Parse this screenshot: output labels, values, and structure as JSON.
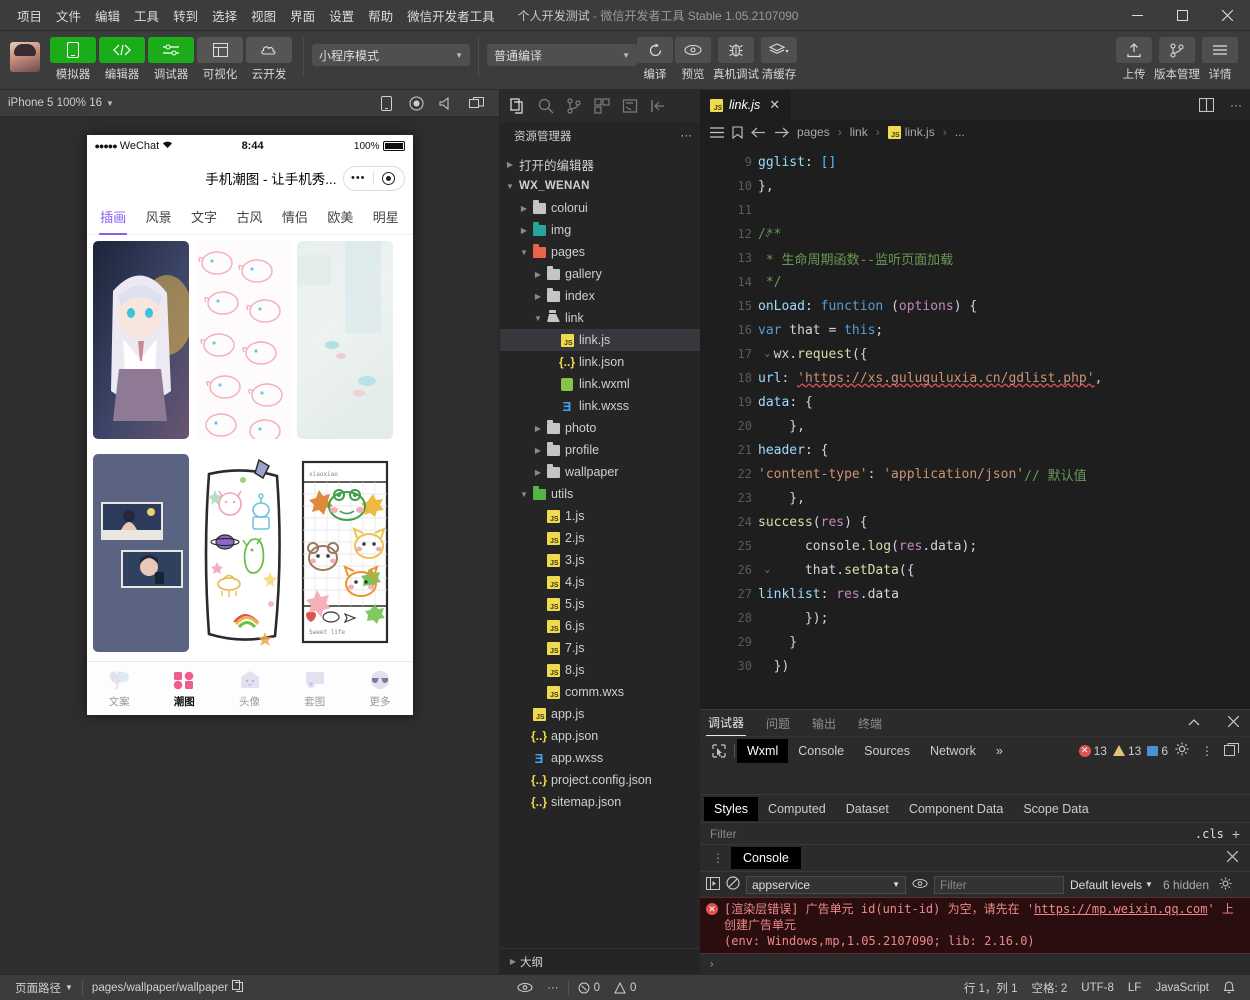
{
  "titlebar": {
    "menu": [
      "项目",
      "文件",
      "编辑",
      "工具",
      "转到",
      "选择",
      "视图",
      "界面",
      "设置",
      "帮助",
      "微信开发者工具"
    ],
    "project": "个人开发测试",
    "app": "- 微信开发者工具 Stable 1.05.2107090",
    "minimize": "—",
    "maximize": "▢",
    "close": "✕"
  },
  "toolbar": {
    "buttons": [
      {
        "label": "模拟器",
        "icon": "phone-icon",
        "style": "green"
      },
      {
        "label": "编辑器",
        "icon": "code-icon",
        "style": "green"
      },
      {
        "label": "调试器",
        "icon": "sliders-icon",
        "style": "green"
      },
      {
        "label": "可视化",
        "icon": "layout-icon",
        "style": "grey"
      },
      {
        "label": "云开发",
        "icon": "cloud-icon",
        "style": "grey"
      }
    ],
    "mode_select": "小程序模式",
    "compile_select": "普通编译",
    "actions": [
      {
        "label": "编译",
        "icon": "refresh-icon"
      },
      {
        "label": "预览",
        "icon": "eye-icon"
      },
      {
        "label": "真机调试",
        "icon": "bug-icon"
      },
      {
        "label": "清缓存",
        "icon": "layers-icon"
      }
    ],
    "right_actions": [
      {
        "label": "上传",
        "icon": "upload-icon"
      },
      {
        "label": "版本管理",
        "icon": "branch-icon"
      },
      {
        "label": "详情",
        "icon": "menu-icon"
      }
    ]
  },
  "simulator": {
    "device": "iPhone 5 100% 16",
    "icons": [
      "phone-rotate-icon",
      "record-icon",
      "volume-icon",
      "screenshot-icon"
    ],
    "phone": {
      "carrier": "WeChat",
      "time": "8:44",
      "battery": "100%",
      "title": "手机潮图 - 让手机秀...",
      "capsule_more": "•••",
      "categories": [
        {
          "label": "插画",
          "active": true
        },
        {
          "label": "风景",
          "active": false
        },
        {
          "label": "文字",
          "active": false
        },
        {
          "label": "古风",
          "active": false
        },
        {
          "label": "情侣",
          "active": false
        },
        {
          "label": "欧美",
          "active": false
        },
        {
          "label": "明星",
          "active": false
        }
      ],
      "tabbar": [
        {
          "label": "文案",
          "icon": "heart-balloon-icon",
          "active": false
        },
        {
          "label": "潮图",
          "icon": "grid-squares-icon",
          "active": true
        },
        {
          "label": "头像",
          "icon": "ghost-icon",
          "active": false
        },
        {
          "label": "套图",
          "icon": "album-icon",
          "active": false
        },
        {
          "label": "更多",
          "icon": "sunglasses-icon",
          "active": false
        }
      ]
    }
  },
  "explorer": {
    "activity_icons": [
      "files-icon",
      "search-icon",
      "source-control-icon",
      "extensions-icon",
      "debug-icon",
      "collapse-icon"
    ],
    "title": "资源管理器",
    "more": "···",
    "open_editors": "打开的编辑器",
    "root": "WX_WENAN",
    "outline": "大纲",
    "tree": [
      {
        "name": "colorui",
        "type": "folder",
        "depth": 1,
        "expanded": false
      },
      {
        "name": "img",
        "type": "folder-img",
        "depth": 1,
        "expanded": false
      },
      {
        "name": "pages",
        "type": "folder-red",
        "depth": 1,
        "expanded": true
      },
      {
        "name": "gallery",
        "type": "folder",
        "depth": 2,
        "expanded": false
      },
      {
        "name": "index",
        "type": "folder",
        "depth": 2,
        "expanded": false
      },
      {
        "name": "link",
        "type": "folder-open",
        "depth": 2,
        "expanded": true
      },
      {
        "name": "link.js",
        "type": "js",
        "depth": 3,
        "selected": true
      },
      {
        "name": "link.json",
        "type": "json",
        "depth": 3
      },
      {
        "name": "link.wxml",
        "type": "wxml",
        "depth": 3
      },
      {
        "name": "link.wxss",
        "type": "wxss",
        "depth": 3
      },
      {
        "name": "photo",
        "type": "folder",
        "depth": 2,
        "expanded": false
      },
      {
        "name": "profile",
        "type": "folder",
        "depth": 2,
        "expanded": false
      },
      {
        "name": "wallpaper",
        "type": "folder",
        "depth": 2,
        "expanded": false
      },
      {
        "name": "utils",
        "type": "folder-green",
        "depth": 1,
        "expanded": true
      },
      {
        "name": "1.js",
        "type": "js",
        "depth": 2
      },
      {
        "name": "2.js",
        "type": "js",
        "depth": 2
      },
      {
        "name": "3.js",
        "type": "js",
        "depth": 2
      },
      {
        "name": "4.js",
        "type": "js",
        "depth": 2
      },
      {
        "name": "5.js",
        "type": "js",
        "depth": 2
      },
      {
        "name": "6.js",
        "type": "js",
        "depth": 2
      },
      {
        "name": "7.js",
        "type": "js",
        "depth": 2
      },
      {
        "name": "8.js",
        "type": "js",
        "depth": 2
      },
      {
        "name": "comm.wxs",
        "type": "js",
        "depth": 2
      },
      {
        "name": "app.js",
        "type": "js",
        "depth": 1
      },
      {
        "name": "app.json",
        "type": "json",
        "depth": 1
      },
      {
        "name": "app.wxss",
        "type": "wxss",
        "depth": 1
      },
      {
        "name": "project.config.json",
        "type": "json",
        "depth": 1
      },
      {
        "name": "sitemap.json",
        "type": "json",
        "depth": 1
      }
    ]
  },
  "editor": {
    "tab": "link.js",
    "tab_close": "✕",
    "breadcrumb": [
      "pages",
      "link",
      "link.js",
      "..."
    ],
    "first_line_no": 9,
    "lines": [
      {
        "no": 9,
        "fold": false,
        "text": "  gglist: []"
      },
      {
        "no": 10,
        "fold": false,
        "text": "},"
      },
      {
        "no": 11,
        "fold": false,
        "text": ""
      },
      {
        "no": 12,
        "fold": true,
        "text": "/**"
      },
      {
        "no": 13,
        "fold": false,
        "text": " * 生命周期函数--监听页面加载"
      },
      {
        "no": 14,
        "fold": false,
        "text": " */"
      },
      {
        "no": 15,
        "fold": true,
        "text": "onLoad: function (options) {"
      },
      {
        "no": 16,
        "fold": false,
        "text": "  var that = this;"
      },
      {
        "no": 17,
        "fold": true,
        "text": "  wx.request({"
      },
      {
        "no": 18,
        "fold": false,
        "text": "    url: 'https://xs.guluguluxia.cn/gdlist.php',"
      },
      {
        "no": 19,
        "fold": false,
        "text": "    data: {"
      },
      {
        "no": 20,
        "fold": false,
        "text": "    },"
      },
      {
        "no": 21,
        "fold": true,
        "text": "    header: {"
      },
      {
        "no": 22,
        "fold": false,
        "text": "      'content-type': 'application/json' // 默认值"
      },
      {
        "no": 23,
        "fold": false,
        "text": "    },"
      },
      {
        "no": 24,
        "fold": true,
        "text": "    success(res) {"
      },
      {
        "no": 25,
        "fold": false,
        "text": "      console.log(res.data);"
      },
      {
        "no": 26,
        "fold": true,
        "text": "      that.setData({"
      },
      {
        "no": 27,
        "fold": false,
        "text": "        linklist: res.data"
      },
      {
        "no": 28,
        "fold": false,
        "text": "      });"
      },
      {
        "no": 29,
        "fold": false,
        "text": "    }"
      },
      {
        "no": 30,
        "fold": false,
        "text": "  })"
      }
    ]
  },
  "debugger": {
    "panel_tabs": [
      {
        "label": "调试器",
        "active": true
      },
      {
        "label": "问题",
        "active": false
      },
      {
        "label": "输出",
        "active": false
      },
      {
        "label": "终端",
        "active": false
      }
    ],
    "devtools_tabs": [
      {
        "label": "Wxml",
        "active": true
      },
      {
        "label": "Console",
        "active": false
      },
      {
        "label": "Sources",
        "active": false
      },
      {
        "label": "Network",
        "active": false
      }
    ],
    "overflow": "»",
    "counts": {
      "errors": "13",
      "warnings": "13",
      "info": "6"
    },
    "style_tabs": [
      {
        "label": "Styles",
        "active": true
      },
      {
        "label": "Computed",
        "active": false
      },
      {
        "label": "Dataset",
        "active": false
      },
      {
        "label": "Component Data",
        "active": false
      },
      {
        "label": "Scope Data",
        "active": false
      }
    ],
    "filter_placeholder": "Filter",
    "cls_label": ".cls",
    "plus": "+"
  },
  "console": {
    "tab": "Console",
    "context": "appservice",
    "filter_placeholder": "Filter",
    "levels": "Default levels",
    "hidden": "6 hidden",
    "error_main": "[渲染层错误] 广告单元 id(unit-id) 为空，请先在 ",
    "error_link": "https://mp.weixin.qq.com",
    "error_tail": "' 上创建广告单元",
    "error_quote_open": "'",
    "error_env": "(env: Windows,mp,1.05.2107090; lib: 2.16.0)",
    "prompt": "›"
  },
  "status": {
    "page_path_label": "页面路径",
    "page_path": "pages/wallpaper/wallpaper",
    "errors": "0",
    "warnings": "0",
    "cursor": "行 1，列 1",
    "spaces": "空格: 2",
    "encoding": "UTF-8",
    "eol": "LF",
    "language": "JavaScript"
  },
  "colors": {
    "wechat_green": "#1aad19",
    "accent_purple": "#8b5cf6",
    "error_red": "#e05252",
    "warn_yellow": "#e5c07b"
  }
}
